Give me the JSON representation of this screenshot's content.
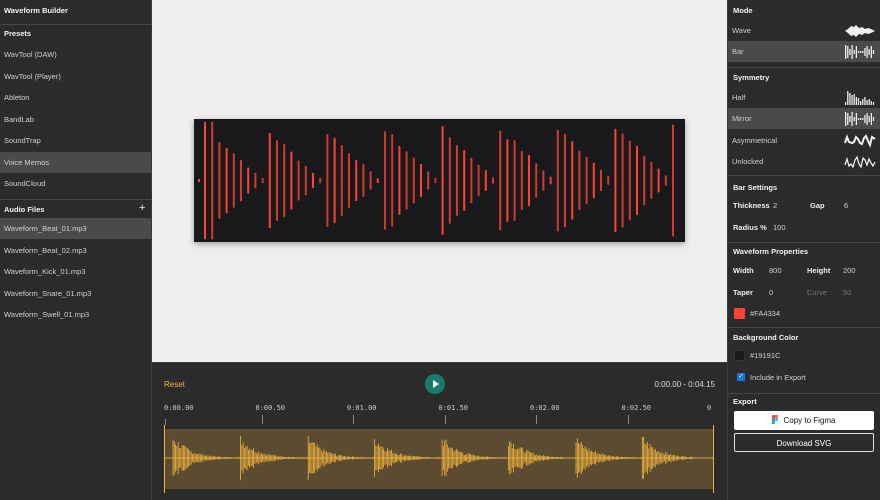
{
  "app": {
    "title": "Waveform Builder"
  },
  "presets": {
    "header": "Presets",
    "items": [
      {
        "label": "WavTool (DAW)"
      },
      {
        "label": "WavTool (Player)"
      },
      {
        "label": "Ableton"
      },
      {
        "label": "BandLab"
      },
      {
        "label": "SoundTrap"
      },
      {
        "label": "Voice Memos",
        "selected": true
      },
      {
        "label": "SoundCloud"
      }
    ]
  },
  "audio_files": {
    "header": "Audio Files",
    "add_label": "+",
    "items": [
      {
        "label": "Waveform_Beat_01.mp3",
        "selected": true
      },
      {
        "label": "Waveform_Beat_02.mp3"
      },
      {
        "label": "Waveform_Kick_01.mp3"
      },
      {
        "label": "Waveform_Snare_01.mp3"
      },
      {
        "label": "Waveform_Swell_01.mp3"
      }
    ]
  },
  "mode": {
    "header": "Mode",
    "items": [
      {
        "label": "Wave"
      },
      {
        "label": "Bar",
        "selected": true
      }
    ]
  },
  "symmetry": {
    "header": "Symmetry",
    "items": [
      {
        "label": "Half"
      },
      {
        "label": "Mirror",
        "selected": true
      },
      {
        "label": "Asymmetrical"
      },
      {
        "label": "Unlocked"
      }
    ]
  },
  "bar_settings": {
    "header": "Bar Settings",
    "thickness_label": "Thickness",
    "thickness": "2",
    "gap_label": "Gap",
    "gap": "6",
    "radius_label": "Radius %",
    "radius": "100"
  },
  "waveform_properties": {
    "header": "Waveform Properties",
    "width_label": "Width",
    "width": "800",
    "height_label": "Height",
    "height": "200",
    "taper_label": "Taper",
    "taper": "0",
    "curve_label": "Curve",
    "curve": "50",
    "color": "#FA4334"
  },
  "background": {
    "header": "Background Color",
    "color": "#19191C",
    "include_label": "Include in Export",
    "include": true
  },
  "export": {
    "header": "Export",
    "copy_label": "Copy to Figma",
    "download_label": "Download SVG"
  },
  "player": {
    "reset_label": "Reset",
    "time": "0:00.00 - 0:04.15",
    "ticks": [
      "0:00.00",
      "0:00.50",
      "0:01.00",
      "0:01.50",
      "0:02.00",
      "0:02.50",
      "0"
    ],
    "accent": "#F2B43C",
    "play_color": "#1A7A6E"
  }
}
